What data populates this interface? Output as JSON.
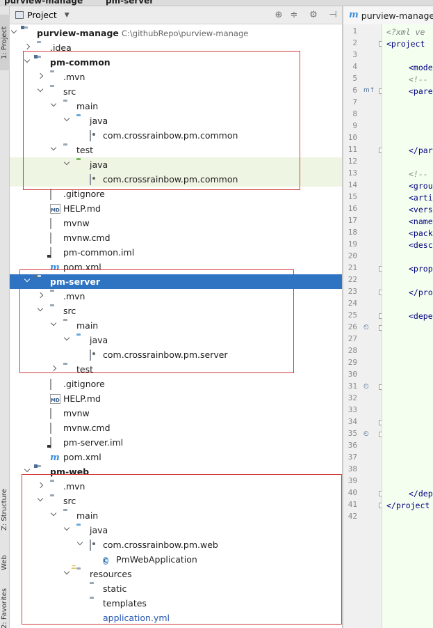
{
  "titlebar": {
    "crumb1": "purview-manage",
    "crumb2": "pm-server"
  },
  "left_strip": {
    "project_tab": "1: Project",
    "structure_tab": "Z: Structure",
    "web_tab": "Web",
    "favorites_tab": "2: Favorites"
  },
  "project_panel": {
    "title": "Project",
    "toolbar_icons": [
      "crosshair-icon",
      "collapse-icon",
      "gear-icon",
      "hide-icon"
    ]
  },
  "tree": [
    {
      "label": "purview-manage",
      "path": "C:\\githubRepo\\purview-manage",
      "icon": "module-folder",
      "arrow": "down",
      "depth": 0,
      "bold": true
    },
    {
      "label": ".idea",
      "icon": "folder",
      "arrow": "right",
      "depth": 1
    },
    {
      "label": "pm-common",
      "icon": "module-folder",
      "arrow": "down",
      "depth": 1,
      "bold": true
    },
    {
      "label": ".mvn",
      "icon": "folder",
      "arrow": "right",
      "depth": 2
    },
    {
      "label": "src",
      "icon": "folder",
      "arrow": "down",
      "depth": 2
    },
    {
      "label": "main",
      "icon": "folder",
      "arrow": "down",
      "depth": 3
    },
    {
      "label": "java",
      "icon": "source-folder",
      "arrow": "down",
      "depth": 4
    },
    {
      "label": "com.crossrainbow.pm.common",
      "icon": "package",
      "arrow": "none",
      "depth": 5
    },
    {
      "label": "test",
      "icon": "folder",
      "arrow": "down",
      "depth": 3
    },
    {
      "label": "java",
      "icon": "test-folder",
      "arrow": "down",
      "depth": 4,
      "highlight": true
    },
    {
      "label": "com.crossrainbow.pm.common",
      "icon": "package",
      "arrow": "none",
      "depth": 5,
      "highlight": true
    },
    {
      "label": ".gitignore",
      "icon": "file",
      "arrow": "none",
      "depth": 2
    },
    {
      "label": "HELP.md",
      "icon": "md-file",
      "arrow": "none",
      "depth": 2
    },
    {
      "label": "mvnw",
      "icon": "file",
      "arrow": "none",
      "depth": 2
    },
    {
      "label": "mvnw.cmd",
      "icon": "file",
      "arrow": "none",
      "depth": 2
    },
    {
      "label": "pm-common.iml",
      "icon": "iml-file",
      "arrow": "none",
      "depth": 2
    },
    {
      "label": "pom.xml",
      "icon": "maven-file",
      "arrow": "none",
      "depth": 2
    },
    {
      "label": "pm-server",
      "icon": "module-folder",
      "arrow": "down",
      "depth": 1,
      "bold": true,
      "selected": true
    },
    {
      "label": ".mvn",
      "icon": "folder",
      "arrow": "right",
      "depth": 2
    },
    {
      "label": "src",
      "icon": "folder",
      "arrow": "down",
      "depth": 2
    },
    {
      "label": "main",
      "icon": "folder",
      "arrow": "down",
      "depth": 3
    },
    {
      "label": "java",
      "icon": "source-folder",
      "arrow": "down",
      "depth": 4
    },
    {
      "label": "com.crossrainbow.pm.server",
      "icon": "package",
      "arrow": "none",
      "depth": 5
    },
    {
      "label": "test",
      "icon": "folder",
      "arrow": "right",
      "depth": 3
    },
    {
      "label": ".gitignore",
      "icon": "file",
      "arrow": "none",
      "depth": 2
    },
    {
      "label": "HELP.md",
      "icon": "md-file",
      "arrow": "none",
      "depth": 2
    },
    {
      "label": "mvnw",
      "icon": "file",
      "arrow": "none",
      "depth": 2
    },
    {
      "label": "mvnw.cmd",
      "icon": "file",
      "arrow": "none",
      "depth": 2
    },
    {
      "label": "pm-server.iml",
      "icon": "iml-file",
      "arrow": "none",
      "depth": 2
    },
    {
      "label": "pom.xml",
      "icon": "maven-file",
      "arrow": "none",
      "depth": 2
    },
    {
      "label": "pm-web",
      "icon": "module-folder",
      "arrow": "down",
      "depth": 1,
      "bold": true
    },
    {
      "label": ".mvn",
      "icon": "folder",
      "arrow": "right",
      "depth": 2
    },
    {
      "label": "src",
      "icon": "folder",
      "arrow": "down",
      "depth": 2
    },
    {
      "label": "main",
      "icon": "folder",
      "arrow": "down",
      "depth": 3
    },
    {
      "label": "java",
      "icon": "source-folder",
      "arrow": "down",
      "depth": 4
    },
    {
      "label": "com.crossrainbow.pm.web",
      "icon": "package",
      "arrow": "down",
      "depth": 5
    },
    {
      "label": "PmWebApplication",
      "icon": "spring-class",
      "arrow": "none",
      "depth": 6
    },
    {
      "label": "resources",
      "icon": "resources-folder",
      "arrow": "down",
      "depth": 4
    },
    {
      "label": "static",
      "icon": "folder",
      "arrow": "none",
      "depth": 5
    },
    {
      "label": "templates",
      "icon": "folder",
      "arrow": "none",
      "depth": 5
    },
    {
      "label": "application.yml",
      "icon": "spring-leaf",
      "arrow": "none",
      "depth": 5,
      "blue": true
    }
  ],
  "editor": {
    "tab_label": "purview-manage",
    "line_numbers": [
      "1",
      "2",
      "3",
      "4",
      "5",
      "6",
      "7",
      "8",
      "9",
      "10",
      "11",
      "12",
      "13",
      "14",
      "15",
      "16",
      "17",
      "18",
      "19",
      "20",
      "21",
      "22",
      "23",
      "24",
      "25",
      "26",
      "27",
      "28",
      "29",
      "30",
      "31",
      "32",
      "33",
      "34",
      "35",
      "36",
      "37",
      "38",
      "39",
      "40",
      "41",
      "42"
    ],
    "current_line": 38,
    "code_lines": [
      {
        "n": 1,
        "text": "<?xml ve",
        "cls": "cmt",
        "indent": 0
      },
      {
        "n": 2,
        "text": "<project",
        "cls": "tag",
        "indent": 0
      },
      {
        "n": 4,
        "text": "<mode",
        "cls": "tag",
        "indent": 1
      },
      {
        "n": 5,
        "text": "<!--",
        "cls": "cmt",
        "indent": 1
      },
      {
        "n": 6,
        "text": "<pare",
        "cls": "tag",
        "indent": 1
      },
      {
        "n": 11,
        "text": "</par",
        "cls": "tag",
        "indent": 1
      },
      {
        "n": 13,
        "text": "<!--",
        "cls": "cmt",
        "indent": 1
      },
      {
        "n": 14,
        "text": "<grou",
        "cls": "tag",
        "indent": 1
      },
      {
        "n": 15,
        "text": "<arti",
        "cls": "tag",
        "indent": 1
      },
      {
        "n": 16,
        "text": "<vers",
        "cls": "tag",
        "indent": 1
      },
      {
        "n": 17,
        "text": "<name",
        "cls": "tag",
        "indent": 1
      },
      {
        "n": 18,
        "text": "<pack",
        "cls": "tag",
        "indent": 1
      },
      {
        "n": 19,
        "text": "<desc",
        "cls": "tag",
        "indent": 1
      },
      {
        "n": 21,
        "text": "<prop",
        "cls": "tag",
        "indent": 1
      },
      {
        "n": 23,
        "text": "</pro",
        "cls": "tag",
        "indent": 1
      },
      {
        "n": 25,
        "text": "<depe",
        "cls": "tag",
        "indent": 1
      },
      {
        "n": 40,
        "text": "</dep",
        "cls": "tag",
        "indent": 1
      },
      {
        "n": 41,
        "text": "</project",
        "cls": "tag",
        "indent": 0
      }
    ],
    "fold_lines": [
      2,
      6,
      11,
      21,
      23,
      25,
      26,
      31,
      34,
      35,
      40,
      41
    ],
    "gutter_marks": [
      {
        "n": 6,
        "icon": "override-icon",
        "text": "m↑"
      },
      {
        "n": 26,
        "icon": "implemented-icon",
        "text": "◴"
      },
      {
        "n": 31,
        "icon": "implemented-icon",
        "text": "◴"
      },
      {
        "n": 35,
        "icon": "implemented-icon",
        "text": "◴"
      }
    ]
  }
}
